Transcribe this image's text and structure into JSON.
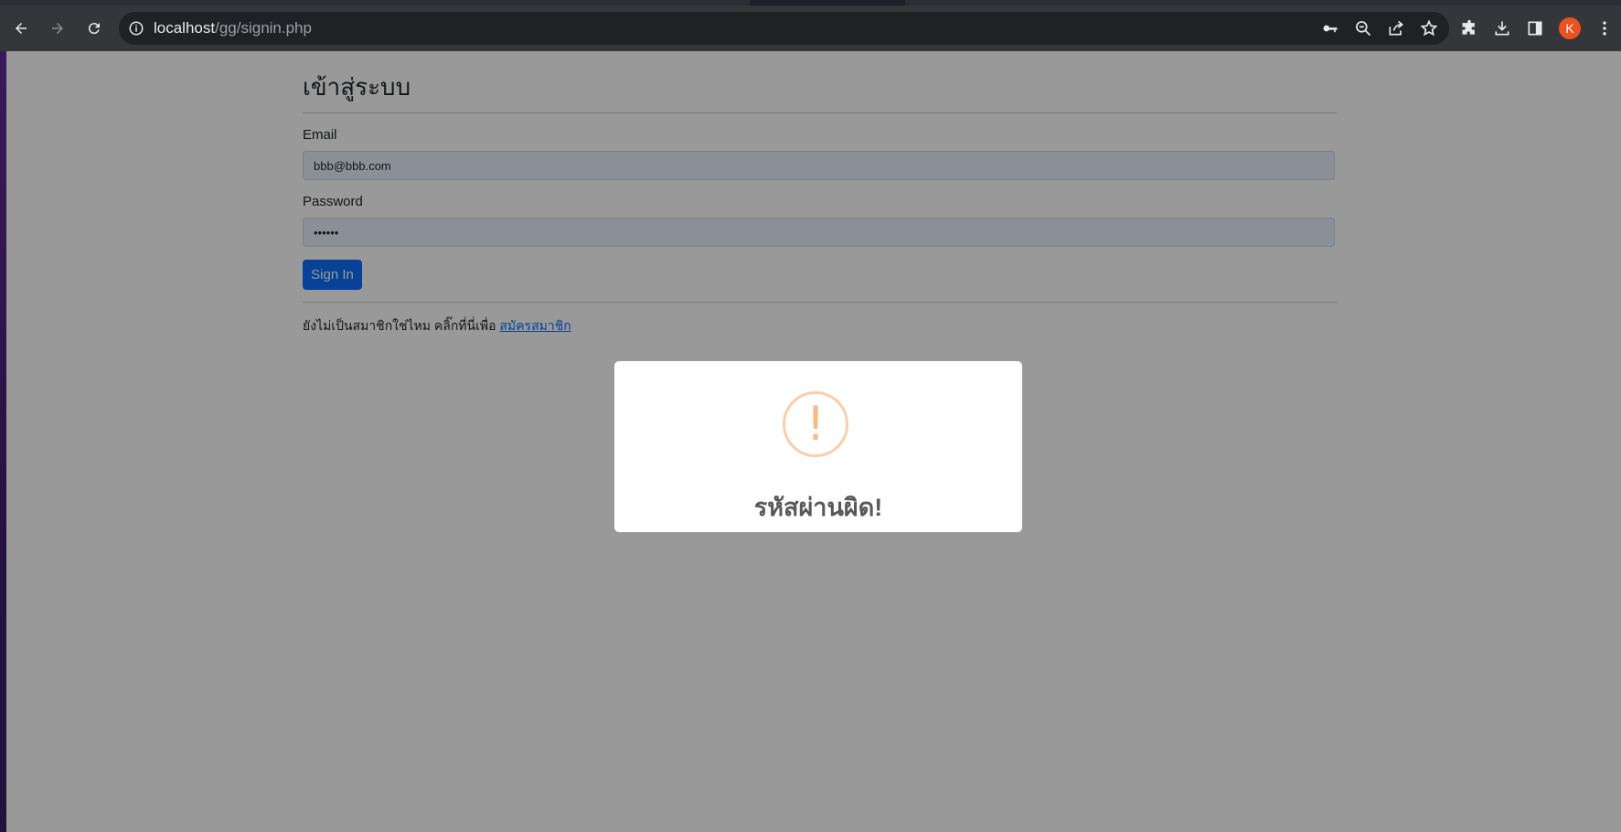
{
  "browser": {
    "url_host": "localhost",
    "url_path": "/gg/signin.php",
    "avatar_letter": "K",
    "icons": [
      "back-icon",
      "forward-icon",
      "reload-icon",
      "info-icon",
      "key-icon",
      "zoom-out-icon",
      "share-icon",
      "star-icon",
      "extensions-icon",
      "download-icon",
      "sidepanel-icon",
      "menu-icon"
    ]
  },
  "page": {
    "heading": "เข้าสู่ระบบ",
    "email_label": "Email",
    "email_value": "bbb@bbb.com",
    "password_label": "Password",
    "password_value": "••••••",
    "signin_label": "Sign In",
    "signup_prompt": "ยังไม่เป็นสมาชิกใช่ไหม คลิ๊กที่นี่เพื่อ",
    "signup_link": "สมัครสมาชิก"
  },
  "modal": {
    "icon": "!",
    "title": "รหัสผ่านผิด!",
    "icon_color": "#f8bb86"
  },
  "colors": {
    "primary": "#0d6efd",
    "avatar": "#e8531f"
  }
}
